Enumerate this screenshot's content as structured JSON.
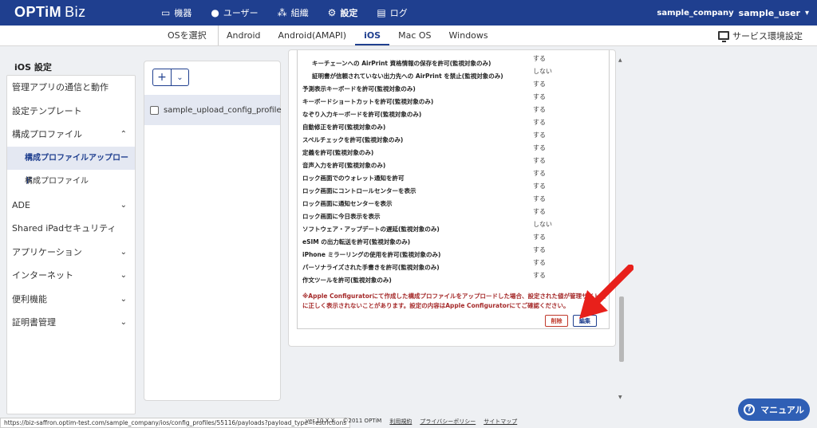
{
  "header": {
    "logo_main": "OPTiM",
    "logo_sub": "Biz",
    "nav": [
      {
        "label": "機器",
        "icon": "▭"
      },
      {
        "label": "ユーザー",
        "icon": "●"
      },
      {
        "label": "組織",
        "icon": "⁂"
      },
      {
        "label": "設定",
        "icon": "⚙"
      },
      {
        "label": "ログ",
        "icon": "▤"
      }
    ],
    "company": "sample_company",
    "user": "sample_user",
    "user_dropdown": "▾"
  },
  "osbar": {
    "select_label": "OSを選択",
    "tabs": [
      "Android",
      "Android(AMAPI)",
      "iOS",
      "Mac OS",
      "Windows"
    ],
    "active_tab": "iOS",
    "service_env": "サービス環境設定"
  },
  "sidebar": {
    "title": "iOS 設定",
    "items": [
      {
        "label": "管理アプリの通信と動作"
      },
      {
        "label": "設定テンプレート"
      },
      {
        "label": "構成プロファイル",
        "chevron": "⌃"
      },
      {
        "label": "構成プロファイルアップロード"
      },
      {
        "label": "構成プロファイル"
      },
      {
        "label": "ADE",
        "chevron": "⌄"
      },
      {
        "label": "Shared iPadセキュリティ"
      },
      {
        "label": "アプリケーション",
        "chevron": "⌄"
      },
      {
        "label": "インターネット",
        "chevron": "⌄"
      },
      {
        "label": "便利機能",
        "chevron": "⌄"
      },
      {
        "label": "証明書管理",
        "chevron": "⌄"
      }
    ]
  },
  "middle": {
    "add_label": "+",
    "dropdown_label": "⌄",
    "file_name": "sample_upload_config_profile"
  },
  "detail": {
    "rows": [
      {
        "label": "キーチェーンへの AirPrint 資格情報の保存を許可(監視対象のみ)",
        "value": "する"
      },
      {
        "label": "証明書が信頼されていない出力先への AirPrint を禁止(監視対象のみ)",
        "value": "しない"
      },
      {
        "label": "予測表示キーボードを許可(監視対象のみ)",
        "value": "する"
      },
      {
        "label": "キーボードショートカットを許可(監視対象のみ)",
        "value": "する"
      },
      {
        "label": "なぞり入力キーボードを許可(監視対象のみ)",
        "value": "する"
      },
      {
        "label": "自動修正を許可(監視対象のみ)",
        "value": "する"
      },
      {
        "label": "スペルチェックを許可(監視対象のみ)",
        "value": "する"
      },
      {
        "label": "定義を許可(監視対象のみ)",
        "value": "する"
      },
      {
        "label": "音声入力を許可(監視対象のみ)",
        "value": "する"
      },
      {
        "label": "ロック画面でのウォレット通知を許可",
        "value": "する"
      },
      {
        "label": "ロック画面にコントロールセンターを表示",
        "value": "する"
      },
      {
        "label": "ロック画面に通知センターを表示",
        "value": "する"
      },
      {
        "label": "ロック画面に今日表示を表示",
        "value": "する"
      },
      {
        "label": "ソフトウェア・アップデートの遅延(監視対象のみ)",
        "value": "しない"
      },
      {
        "label": "eSIM の出力転送を許可(監視対象のみ)",
        "value": "する"
      },
      {
        "label": "iPhone ミラーリングの使用を許可(監視対象のみ)",
        "value": "する"
      },
      {
        "label": "パーソナライズされた手書きを許可(監視対象のみ)",
        "value": "する"
      },
      {
        "label": "作文ツールを許可(監視対象のみ)",
        "value": "する"
      }
    ],
    "note": "※Apple Configuratorにて作成した構成プロファイルをアップロードした場合、設定された値が管理サイト上に正しく表示されないことがあります。設定の内容はApple Configuratorにてご確認ください。",
    "delete_label": "削除",
    "edit_label": "編集"
  },
  "footer": {
    "status_url": "https://biz-saffron.optim-test.com/sample_company/ios/config_profiles/55116/payloads?payload_type=restrictions",
    "version": "ver 10.X.X",
    "copyright": "©2011 OPTiM",
    "terms": "利用規約",
    "privacy": "プライバシーポリシー",
    "sitemap": "サイトマップ"
  },
  "manual": {
    "label": "マニュアル",
    "icon": "?"
  },
  "colors": {
    "brand": "#1f3f8f",
    "arrow": "#e8201b",
    "warning": "#a52a2a"
  }
}
